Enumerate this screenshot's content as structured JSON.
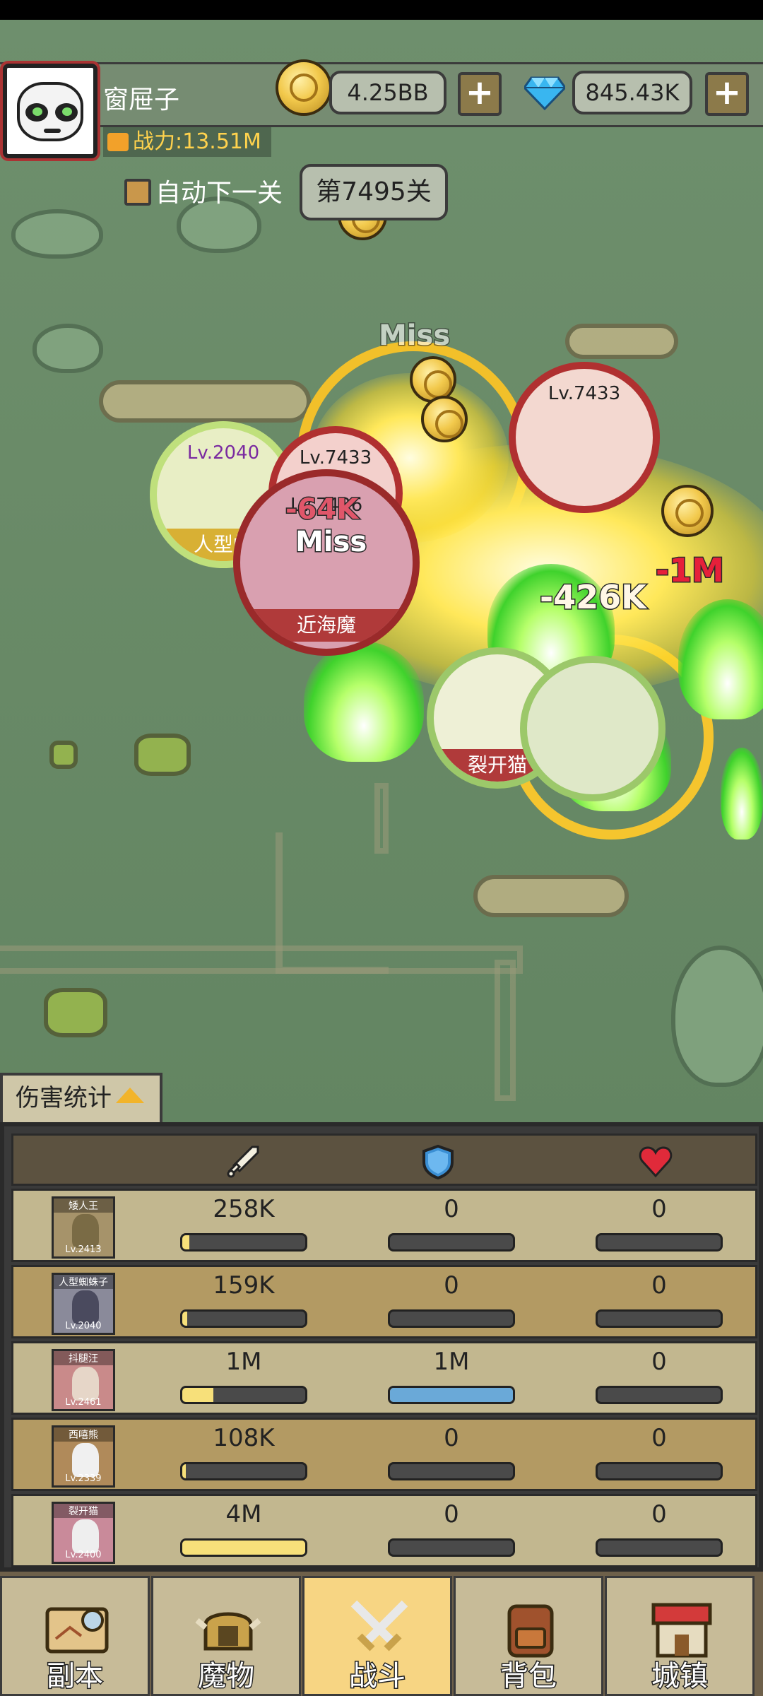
{
  "player": {
    "name": "窗屉子",
    "power": "战力:13.51M"
  },
  "currency": {
    "gold": "4.25BB",
    "gems": "845.43K",
    "add_symbol": "+"
  },
  "stage": {
    "auto_next_label": "自动下一关",
    "current_stage": "第7495关"
  },
  "battle": {
    "units": [
      {
        "level": "Lv.2040",
        "name": "人型蜘"
      },
      {
        "level": "Lv.7436",
        "name": "近海魔"
      },
      {
        "level": "Lv.7433",
        "name": ""
      },
      {
        "level": "Lv.7433",
        "name": ""
      },
      {
        "level": "",
        "name": "裂开猫"
      }
    ],
    "damage_texts": [
      "Miss",
      "-64K",
      "Miss",
      "-426K",
      "-1M",
      "Miss"
    ]
  },
  "damage_stats": {
    "tab_label": "伤害统计",
    "columns": [
      "attack-icon",
      "shield-icon",
      "heart-icon"
    ],
    "rows": [
      {
        "hero": "矮人王",
        "level": "Lv.2413",
        "attack": "258K",
        "defense": "0",
        "heal": "0",
        "attack_fill": 0.06,
        "defense_fill": 0,
        "heal_fill": 0
      },
      {
        "hero": "人型蜘蛛子",
        "level": "Lv.2040",
        "attack": "159K",
        "defense": "0",
        "heal": "0",
        "attack_fill": 0.04,
        "defense_fill": 0,
        "heal_fill": 0
      },
      {
        "hero": "抖腿汪",
        "level": "Lv.2461",
        "attack": "1M",
        "defense": "1M",
        "heal": "0",
        "attack_fill": 0.25,
        "defense_fill": 1.0,
        "heal_fill": 0
      },
      {
        "hero": "西嘻熊",
        "level": "Lv.2339",
        "attack": "108K",
        "defense": "0",
        "heal": "0",
        "attack_fill": 0.03,
        "defense_fill": 0,
        "heal_fill": 0
      },
      {
        "hero": "裂开猫",
        "level": "Lv.2400",
        "attack": "4M",
        "defense": "0",
        "heal": "0",
        "attack_fill": 1.0,
        "defense_fill": 0,
        "heal_fill": 0
      }
    ],
    "colors": {
      "attack_fill": "#f7e07a",
      "defense_fill": "#6aa9d8"
    }
  },
  "nav": {
    "items": [
      "副本",
      "魔物",
      "战斗",
      "背包",
      "城镇"
    ],
    "active": "战斗"
  }
}
